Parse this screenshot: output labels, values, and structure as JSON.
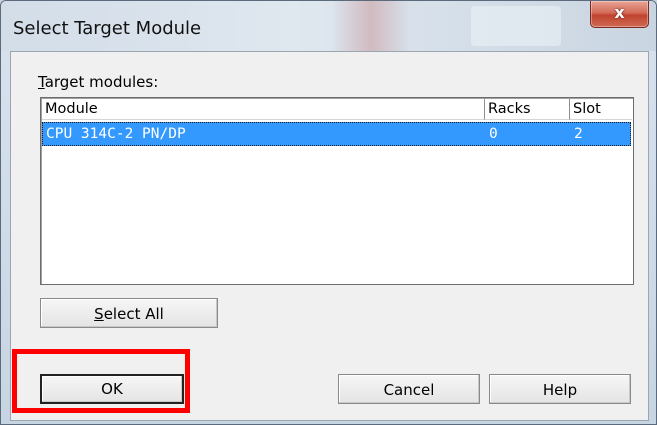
{
  "window": {
    "title": "Select Target Module",
    "close_symbol": "x"
  },
  "target_modules": {
    "label_prefix": "T",
    "label_rest": "arget  modules:",
    "columns": [
      "Module",
      "Racks",
      "Slot"
    ],
    "rows": [
      {
        "module": "CPU 314C-2 PN/DP",
        "racks": "0",
        "slot": "2",
        "selected": true
      }
    ]
  },
  "buttons": {
    "select_all_prefix": "S",
    "select_all_rest": "elect All",
    "ok": "OK",
    "cancel": "Cancel",
    "help": "Help"
  },
  "colors": {
    "selection": "#3399ff",
    "highlight_box": "#ff0000",
    "close_button": "#c9503c"
  },
  "icons": {
    "close": "close-icon"
  }
}
